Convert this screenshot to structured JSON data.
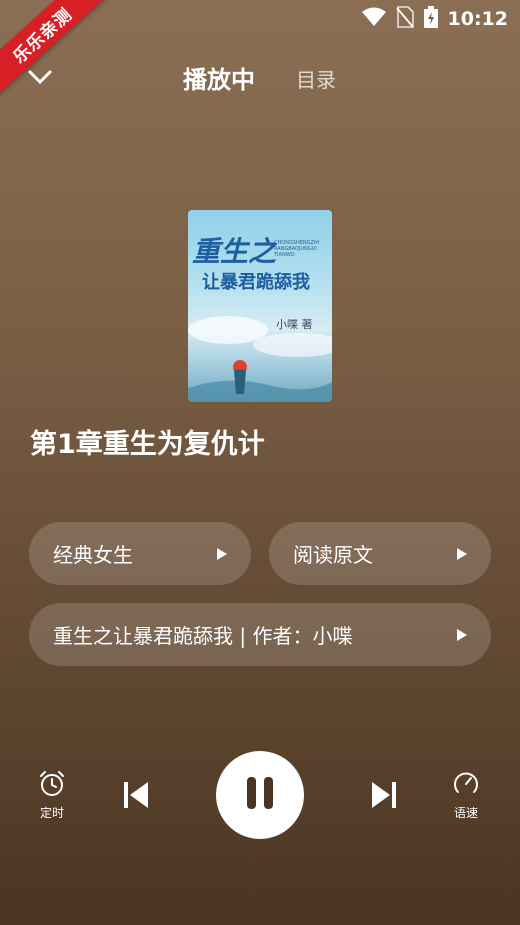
{
  "status": {
    "time": "10:12"
  },
  "ribbon": {
    "text": "乐乐亲测"
  },
  "header": {
    "tab_playing": "播放中",
    "tab_catalog": "目录"
  },
  "cover": {
    "title_line1": "重生之",
    "title_line2": "让暴君跪舔我",
    "author": "小喋 著",
    "pinyin": "CHONGSHENGZHI RANGBAOJUNGUI TIANWO"
  },
  "chapter": {
    "title": "第1章重生为复仇计"
  },
  "pills": {
    "genre": "经典女生",
    "read_original": "阅读原文",
    "book_info": "重生之让暴君跪舔我 | 作者：小喋"
  },
  "controls": {
    "timer_label": "定时",
    "speed_label": "语速",
    "state": "playing"
  },
  "colors": {
    "accent": "#d91f26",
    "cover_text": "#1d5fa0"
  }
}
